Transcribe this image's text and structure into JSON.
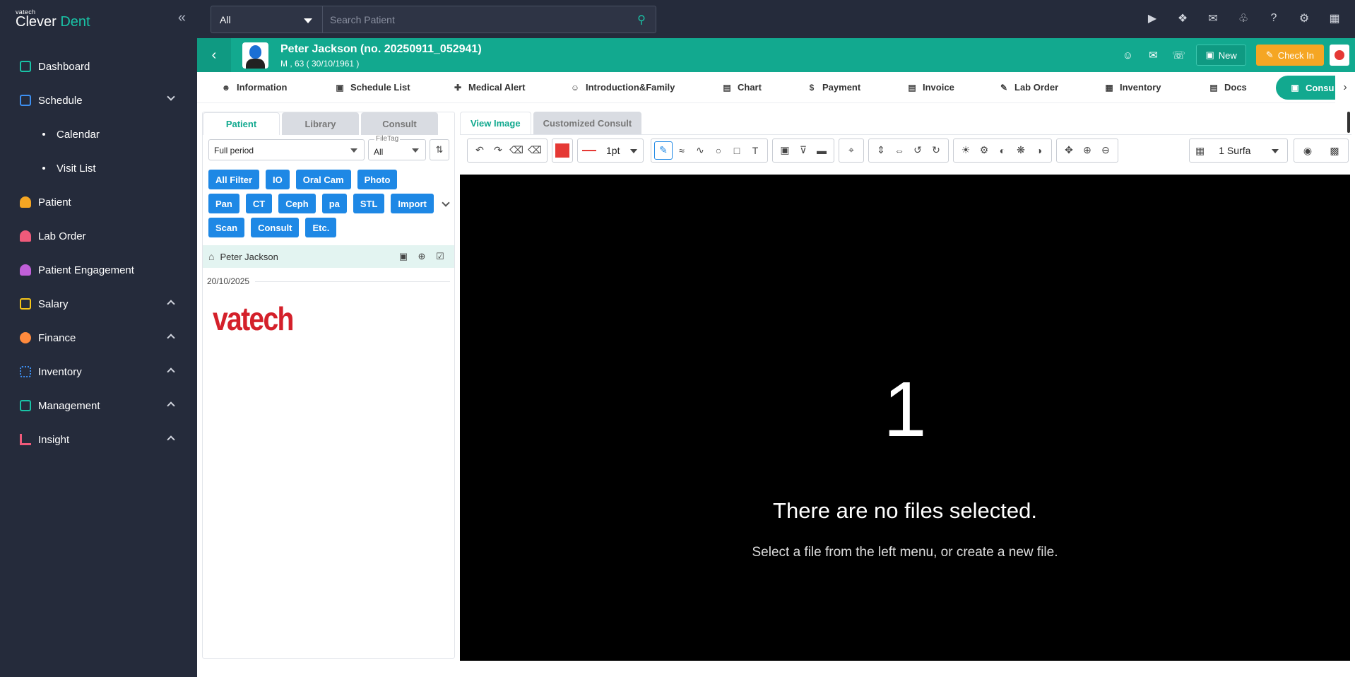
{
  "logo": {
    "small": "vatech",
    "brand_a": "Clever ",
    "brand_b": "Dent"
  },
  "sidebar": {
    "items": [
      {
        "label": "Dashboard"
      },
      {
        "label": "Schedule"
      },
      {
        "label": "Calendar"
      },
      {
        "label": "Visit List"
      },
      {
        "label": "Patient"
      },
      {
        "label": "Lab Order"
      },
      {
        "label": "Patient Engagement"
      },
      {
        "label": "Salary"
      },
      {
        "label": "Finance"
      },
      {
        "label": "Inventory"
      },
      {
        "label": "Management"
      },
      {
        "label": "Insight"
      }
    ]
  },
  "search": {
    "scope": "All",
    "placeholder": "Search Patient"
  },
  "patient": {
    "name": "Peter Jackson (no. 20250911_052941)",
    "info": "M , 63 ( 30/10/1961 )"
  },
  "header_actions": {
    "new_label": "New",
    "checkin_label": "Check In"
  },
  "tabs": [
    {
      "label": "Information"
    },
    {
      "label": "Schedule List"
    },
    {
      "label": "Medical Alert"
    },
    {
      "label": "Introduction&Family"
    },
    {
      "label": "Chart"
    },
    {
      "label": "Payment"
    },
    {
      "label": "Invoice"
    },
    {
      "label": "Lab Order"
    },
    {
      "label": "Inventory"
    },
    {
      "label": "Docs"
    },
    {
      "label": "Consu"
    }
  ],
  "left_panel": {
    "tabs": [
      "Patient",
      "Library",
      "Consult"
    ],
    "period": "Full period",
    "filetag_label": "FileTag",
    "filetag_value": "All",
    "filters": [
      "All Filter",
      "IO",
      "Oral Cam",
      "Photo",
      "Pan",
      "CT",
      "Ceph",
      "pa",
      "STL",
      "Import",
      "Scan",
      "Consult",
      "Etc."
    ],
    "patient_row": "Peter Jackson",
    "date": "20/10/2025",
    "thumbnail_text": "vatech"
  },
  "right_panel": {
    "tabs": [
      "View Image",
      "Customized Consult"
    ],
    "line_width": "1pt",
    "surface": "1 Surfa",
    "color": "#e53935"
  },
  "canvas": {
    "number": "1",
    "message": "There are no files selected.",
    "hint": "Select a file from the left menu, or create a new file."
  },
  "colors": {
    "accent": "#12a98f",
    "sidebar_bg": "#252b3b",
    "chip": "#1e88e5",
    "checkin": "#f5a623"
  }
}
